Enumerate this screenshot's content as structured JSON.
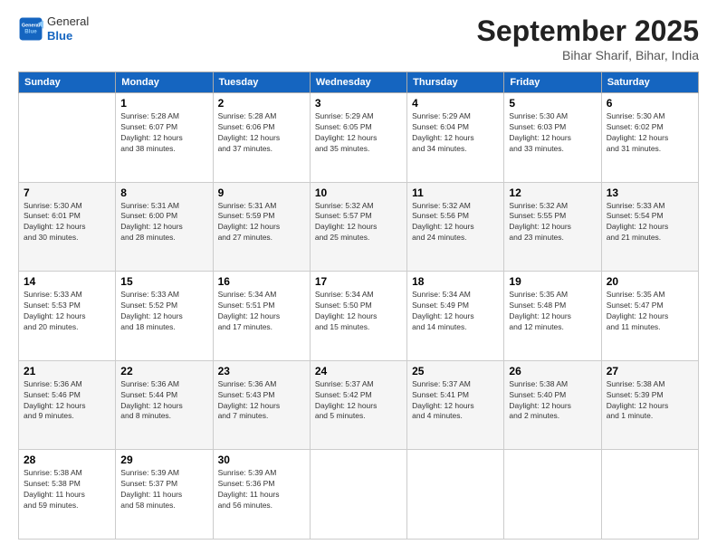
{
  "header": {
    "logo": {
      "line1": "General",
      "line2": "Blue"
    },
    "title": "September 2025",
    "subtitle": "Bihar Sharif, Bihar, India"
  },
  "calendar": {
    "headers": [
      "Sunday",
      "Monday",
      "Tuesday",
      "Wednesday",
      "Thursday",
      "Friday",
      "Saturday"
    ],
    "weeks": [
      [
        {
          "day": "",
          "info": ""
        },
        {
          "day": "1",
          "info": "Sunrise: 5:28 AM\nSunset: 6:07 PM\nDaylight: 12 hours\nand 38 minutes."
        },
        {
          "day": "2",
          "info": "Sunrise: 5:28 AM\nSunset: 6:06 PM\nDaylight: 12 hours\nand 37 minutes."
        },
        {
          "day": "3",
          "info": "Sunrise: 5:29 AM\nSunset: 6:05 PM\nDaylight: 12 hours\nand 35 minutes."
        },
        {
          "day": "4",
          "info": "Sunrise: 5:29 AM\nSunset: 6:04 PM\nDaylight: 12 hours\nand 34 minutes."
        },
        {
          "day": "5",
          "info": "Sunrise: 5:30 AM\nSunset: 6:03 PM\nDaylight: 12 hours\nand 33 minutes."
        },
        {
          "day": "6",
          "info": "Sunrise: 5:30 AM\nSunset: 6:02 PM\nDaylight: 12 hours\nand 31 minutes."
        }
      ],
      [
        {
          "day": "7",
          "info": "Sunrise: 5:30 AM\nSunset: 6:01 PM\nDaylight: 12 hours\nand 30 minutes."
        },
        {
          "day": "8",
          "info": "Sunrise: 5:31 AM\nSunset: 6:00 PM\nDaylight: 12 hours\nand 28 minutes."
        },
        {
          "day": "9",
          "info": "Sunrise: 5:31 AM\nSunset: 5:59 PM\nDaylight: 12 hours\nand 27 minutes."
        },
        {
          "day": "10",
          "info": "Sunrise: 5:32 AM\nSunset: 5:57 PM\nDaylight: 12 hours\nand 25 minutes."
        },
        {
          "day": "11",
          "info": "Sunrise: 5:32 AM\nSunset: 5:56 PM\nDaylight: 12 hours\nand 24 minutes."
        },
        {
          "day": "12",
          "info": "Sunrise: 5:32 AM\nSunset: 5:55 PM\nDaylight: 12 hours\nand 23 minutes."
        },
        {
          "day": "13",
          "info": "Sunrise: 5:33 AM\nSunset: 5:54 PM\nDaylight: 12 hours\nand 21 minutes."
        }
      ],
      [
        {
          "day": "14",
          "info": "Sunrise: 5:33 AM\nSunset: 5:53 PM\nDaylight: 12 hours\nand 20 minutes."
        },
        {
          "day": "15",
          "info": "Sunrise: 5:33 AM\nSunset: 5:52 PM\nDaylight: 12 hours\nand 18 minutes."
        },
        {
          "day": "16",
          "info": "Sunrise: 5:34 AM\nSunset: 5:51 PM\nDaylight: 12 hours\nand 17 minutes."
        },
        {
          "day": "17",
          "info": "Sunrise: 5:34 AM\nSunset: 5:50 PM\nDaylight: 12 hours\nand 15 minutes."
        },
        {
          "day": "18",
          "info": "Sunrise: 5:34 AM\nSunset: 5:49 PM\nDaylight: 12 hours\nand 14 minutes."
        },
        {
          "day": "19",
          "info": "Sunrise: 5:35 AM\nSunset: 5:48 PM\nDaylight: 12 hours\nand 12 minutes."
        },
        {
          "day": "20",
          "info": "Sunrise: 5:35 AM\nSunset: 5:47 PM\nDaylight: 12 hours\nand 11 minutes."
        }
      ],
      [
        {
          "day": "21",
          "info": "Sunrise: 5:36 AM\nSunset: 5:46 PM\nDaylight: 12 hours\nand 9 minutes."
        },
        {
          "day": "22",
          "info": "Sunrise: 5:36 AM\nSunset: 5:44 PM\nDaylight: 12 hours\nand 8 minutes."
        },
        {
          "day": "23",
          "info": "Sunrise: 5:36 AM\nSunset: 5:43 PM\nDaylight: 12 hours\nand 7 minutes."
        },
        {
          "day": "24",
          "info": "Sunrise: 5:37 AM\nSunset: 5:42 PM\nDaylight: 12 hours\nand 5 minutes."
        },
        {
          "day": "25",
          "info": "Sunrise: 5:37 AM\nSunset: 5:41 PM\nDaylight: 12 hours\nand 4 minutes."
        },
        {
          "day": "26",
          "info": "Sunrise: 5:38 AM\nSunset: 5:40 PM\nDaylight: 12 hours\nand 2 minutes."
        },
        {
          "day": "27",
          "info": "Sunrise: 5:38 AM\nSunset: 5:39 PM\nDaylight: 12 hours\nand 1 minute."
        }
      ],
      [
        {
          "day": "28",
          "info": "Sunrise: 5:38 AM\nSunset: 5:38 PM\nDaylight: 11 hours\nand 59 minutes."
        },
        {
          "day": "29",
          "info": "Sunrise: 5:39 AM\nSunset: 5:37 PM\nDaylight: 11 hours\nand 58 minutes."
        },
        {
          "day": "30",
          "info": "Sunrise: 5:39 AM\nSunset: 5:36 PM\nDaylight: 11 hours\nand 56 minutes."
        },
        {
          "day": "",
          "info": ""
        },
        {
          "day": "",
          "info": ""
        },
        {
          "day": "",
          "info": ""
        },
        {
          "day": "",
          "info": ""
        }
      ]
    ]
  }
}
